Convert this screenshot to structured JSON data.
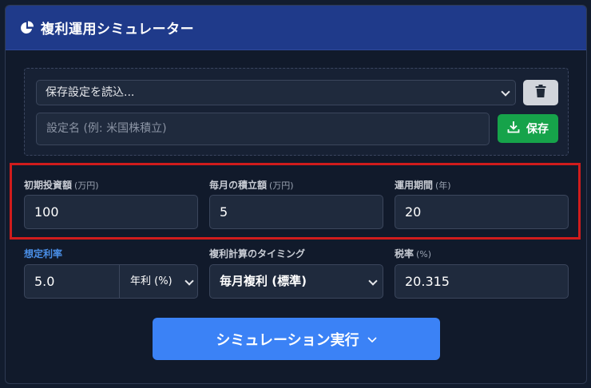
{
  "header": {
    "title": "複利運用シミュレーター",
    "icon": "pie-chart-icon"
  },
  "presets": {
    "select_value": "保存設定を読込...",
    "name_placeholder": "設定名 (例: 米国株積立)",
    "save_label": "保存",
    "delete_icon": "trash-icon",
    "save_icon": "download-icon"
  },
  "fields": {
    "initial": {
      "label": "初期投資額",
      "unit": "(万円)",
      "value": "100"
    },
    "monthly": {
      "label": "毎月の積立額",
      "unit": "(万円)",
      "value": "5"
    },
    "period": {
      "label": "運用期間",
      "unit": "(年)",
      "value": "20"
    },
    "rate": {
      "label": "想定利率",
      "value": "5.0",
      "type_value": "年利 (%)"
    },
    "timing": {
      "label": "複利計算のタイミング",
      "value": "毎月複利 (標準)"
    },
    "tax": {
      "label": "税率",
      "unit": "(%)",
      "value": "20.315"
    }
  },
  "actions": {
    "run_label": "シミュレーション実行",
    "run_icon": "chevron-down-icon"
  },
  "colors": {
    "header_bg": "#1f3a8a",
    "accent": "#3b82f6",
    "save_green": "#16a34a",
    "highlight_red": "#d01c1c"
  }
}
